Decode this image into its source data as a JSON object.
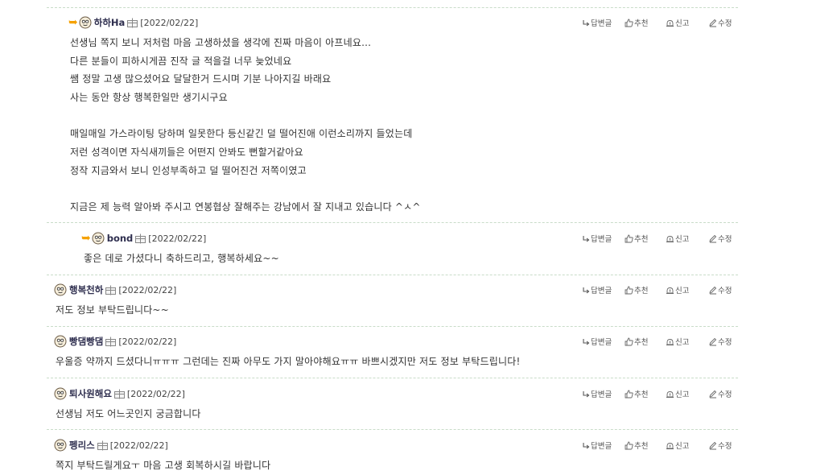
{
  "actions": {
    "reply": "답변글",
    "recommend": "추천",
    "report": "신고",
    "edit": "수정"
  },
  "comments": [
    {
      "author": "하하Ha",
      "date": "[2022/02/22]",
      "lines": [
        "선생님 쪽지 보니 저처럼 마음 고생하셨을 생각에 진짜 마음이 아프네요...",
        "다른 분들이 피하시게끔 진작 글 적을걸 너무 늦었네요",
        "쌤 정말 고생 많으셨어요 달달한거 드시며 기분 나아지길 바래요",
        "사는 동안 항상 행복한일만 생기시구요",
        "",
        "매일매일 가스라이팅 당하며 일못한다 등신같긴 덜 떨어진애 이런소리까지 들었는데",
        "저런 성격이면 자식새끼들은 어떤지 안봐도 뻔할거같아요",
        "정작 지금와서 보니 인성부족하고 덜 떨어진건 저쪽이였고",
        "",
        "지금은 제 능력 알아봐 주시고 연봉협상 잘해주는 강남에서 잘 지내고 있습니다 ^ㅅ^"
      ]
    },
    {
      "author": "bond",
      "date": "[2022/02/22]",
      "lines": [
        "좋은 데로 가셨다니 축하드리고, 행복하세요~~"
      ]
    },
    {
      "author": "행복천하",
      "date": "[2022/02/22]",
      "lines": [
        "저도 정보 부탁드립니다~~"
      ]
    },
    {
      "author": "빵댐빵댐",
      "date": "[2022/02/22]",
      "lines": [
        "우울증 약까지 드셨다니ㅠㅠㅠ 그런데는 진짜 아무도 가지 말아야해요ㅠㅠ 바쁘시겠지만 저도 정보 부탁드립니다!"
      ]
    },
    {
      "author": "퇴사원해요",
      "date": "[2022/02/22]",
      "lines": [
        "선생님 저도 어느곳인지 궁금합니다"
      ]
    },
    {
      "author": "펭리스",
      "date": "[2022/02/22]",
      "lines": [
        "쪽지 부탁드릴게요ㅜ 마음 고생 회복하시길 바랍니다"
      ]
    }
  ]
}
